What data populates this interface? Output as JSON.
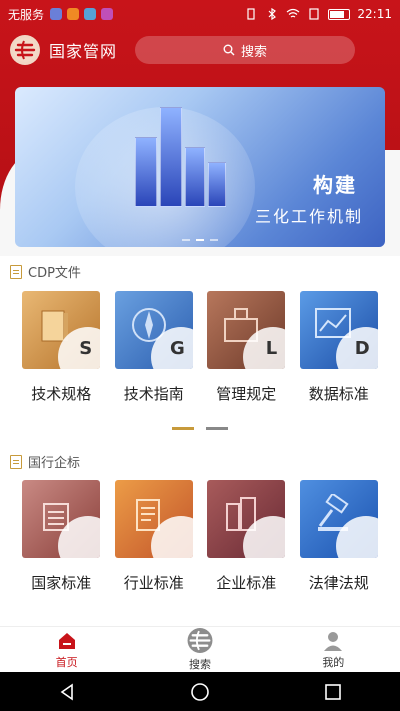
{
  "status_bar": {
    "carrier": "无服务",
    "time": "22:11"
  },
  "header": {
    "app_title": "国家管网",
    "search_label": "搜索"
  },
  "banner": {
    "headline": "构建",
    "subline": "三化工作机制"
  },
  "sections": [
    {
      "title": "CDP文件",
      "items": [
        {
          "label": "技术规格",
          "letter": "S"
        },
        {
          "label": "技术指南",
          "letter": "G"
        },
        {
          "label": "管理规定",
          "letter": "L"
        },
        {
          "label": "数据标准",
          "letter": "D"
        }
      ]
    },
    {
      "title": "国行企标",
      "items": [
        {
          "label": "国家标准"
        },
        {
          "label": "行业标准"
        },
        {
          "label": "企业标准"
        },
        {
          "label": "法律法规"
        }
      ]
    }
  ],
  "tabbar": {
    "home": "首页",
    "search": "搜索",
    "mine": "我的"
  },
  "colors": {
    "brand_red": "#c8141a",
    "accent_gold": "#c79a3b"
  }
}
